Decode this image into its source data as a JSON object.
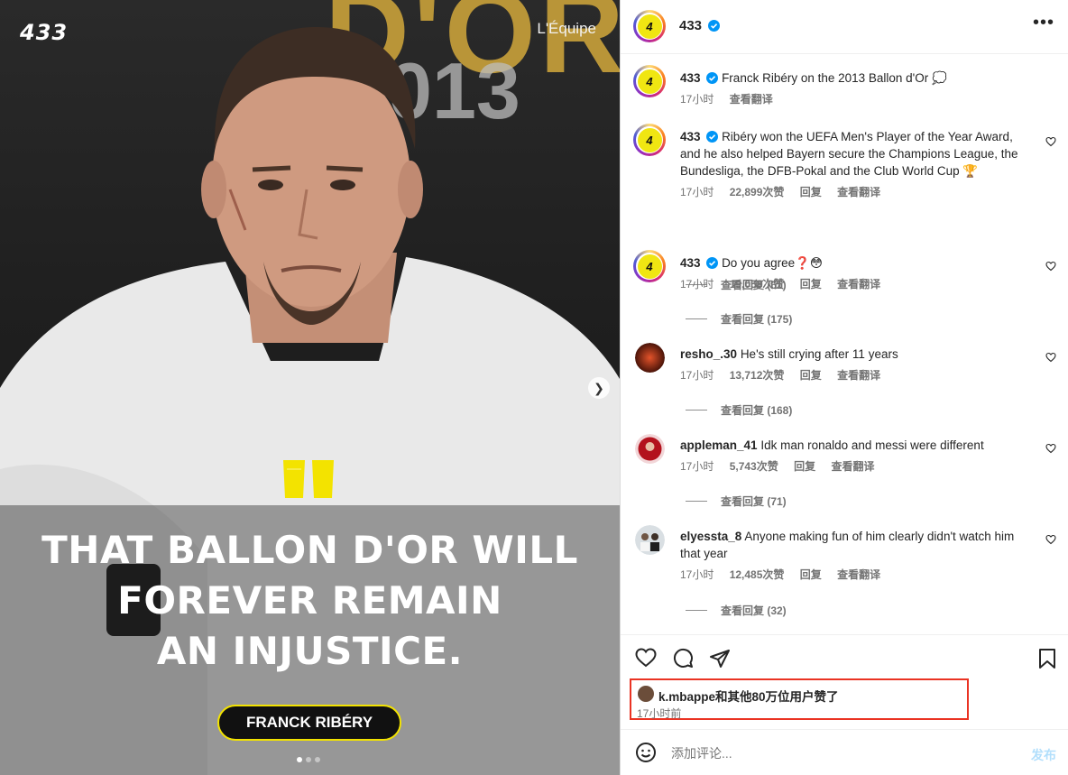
{
  "media": {
    "brand_logo": "433",
    "source_tag": "L'Équipe",
    "bg_letters": "D'OR",
    "bg_year": "013",
    "headline_lines": [
      "THAT BALLON D'OR WILL",
      "FOREVER REMAIN",
      "AN INJUSTICE."
    ],
    "name_pill": "FRANCK RIBÉRY",
    "carousel": {
      "count": 3,
      "active": 1
    },
    "accent_color": "#f3e300"
  },
  "header": {
    "username": "433",
    "verified": true,
    "more_icon": "more-horizontal-icon"
  },
  "comments": [
    {
      "user": "433",
      "verified": true,
      "text": "Franck Ribéry on the 2013 Ballon d'Or 💭",
      "time": "17小时",
      "likes": "",
      "reply": "",
      "translate": "查看翻译",
      "view_replies": ""
    },
    {
      "user": "433",
      "verified": true,
      "text": "Ribéry won the UEFA Men's Player of the Year Award, and he also helped Bayern secure the Champions League, the Bundesliga, the DFB-Pokal and the Club World Cup 🏆",
      "time": "17小时",
      "likes": "22,899次赞",
      "reply": "回复",
      "translate": "查看翻译",
      "view_replies": "查看回复 (61)"
    },
    {
      "user": "433",
      "verified": true,
      "text": "Do you agree❓😳",
      "time": "17小时",
      "likes": "19,058次赞",
      "reply": "回复",
      "translate": "查看翻译",
      "view_replies": "查看回复 (175)"
    },
    {
      "user": "resho_.30",
      "verified": false,
      "text": "He's still crying after 11 years",
      "time": "17小时",
      "likes": "13,712次赞",
      "reply": "回复",
      "translate": "查看翻译",
      "view_replies": "查看回复 (168)"
    },
    {
      "user": "appleman_41",
      "verified": false,
      "text": "Idk man ronaldo and messi were different",
      "time": "17小时",
      "likes": "5,743次赞",
      "reply": "回复",
      "translate": "查看翻译",
      "view_replies": "查看回复 (71)"
    },
    {
      "user": "elyessta_8",
      "verified": false,
      "text": "Anyone making fun of him clearly didn't watch him that year",
      "time": "17小时",
      "likes": "12,485次赞",
      "reply": "回复",
      "translate": "查看翻译",
      "view_replies": "查看回复 (32)"
    }
  ],
  "actions": {
    "icons": [
      "heart-icon",
      "comment-icon",
      "share-icon",
      "bookmark-icon"
    ]
  },
  "likes_summary": {
    "text": "k.mbappe和其他80万位用户赞了",
    "time": "17小时前",
    "highlight_color": "#ea3323"
  },
  "add_comment": {
    "placeholder": "添加评论...",
    "post_label": "发布"
  }
}
